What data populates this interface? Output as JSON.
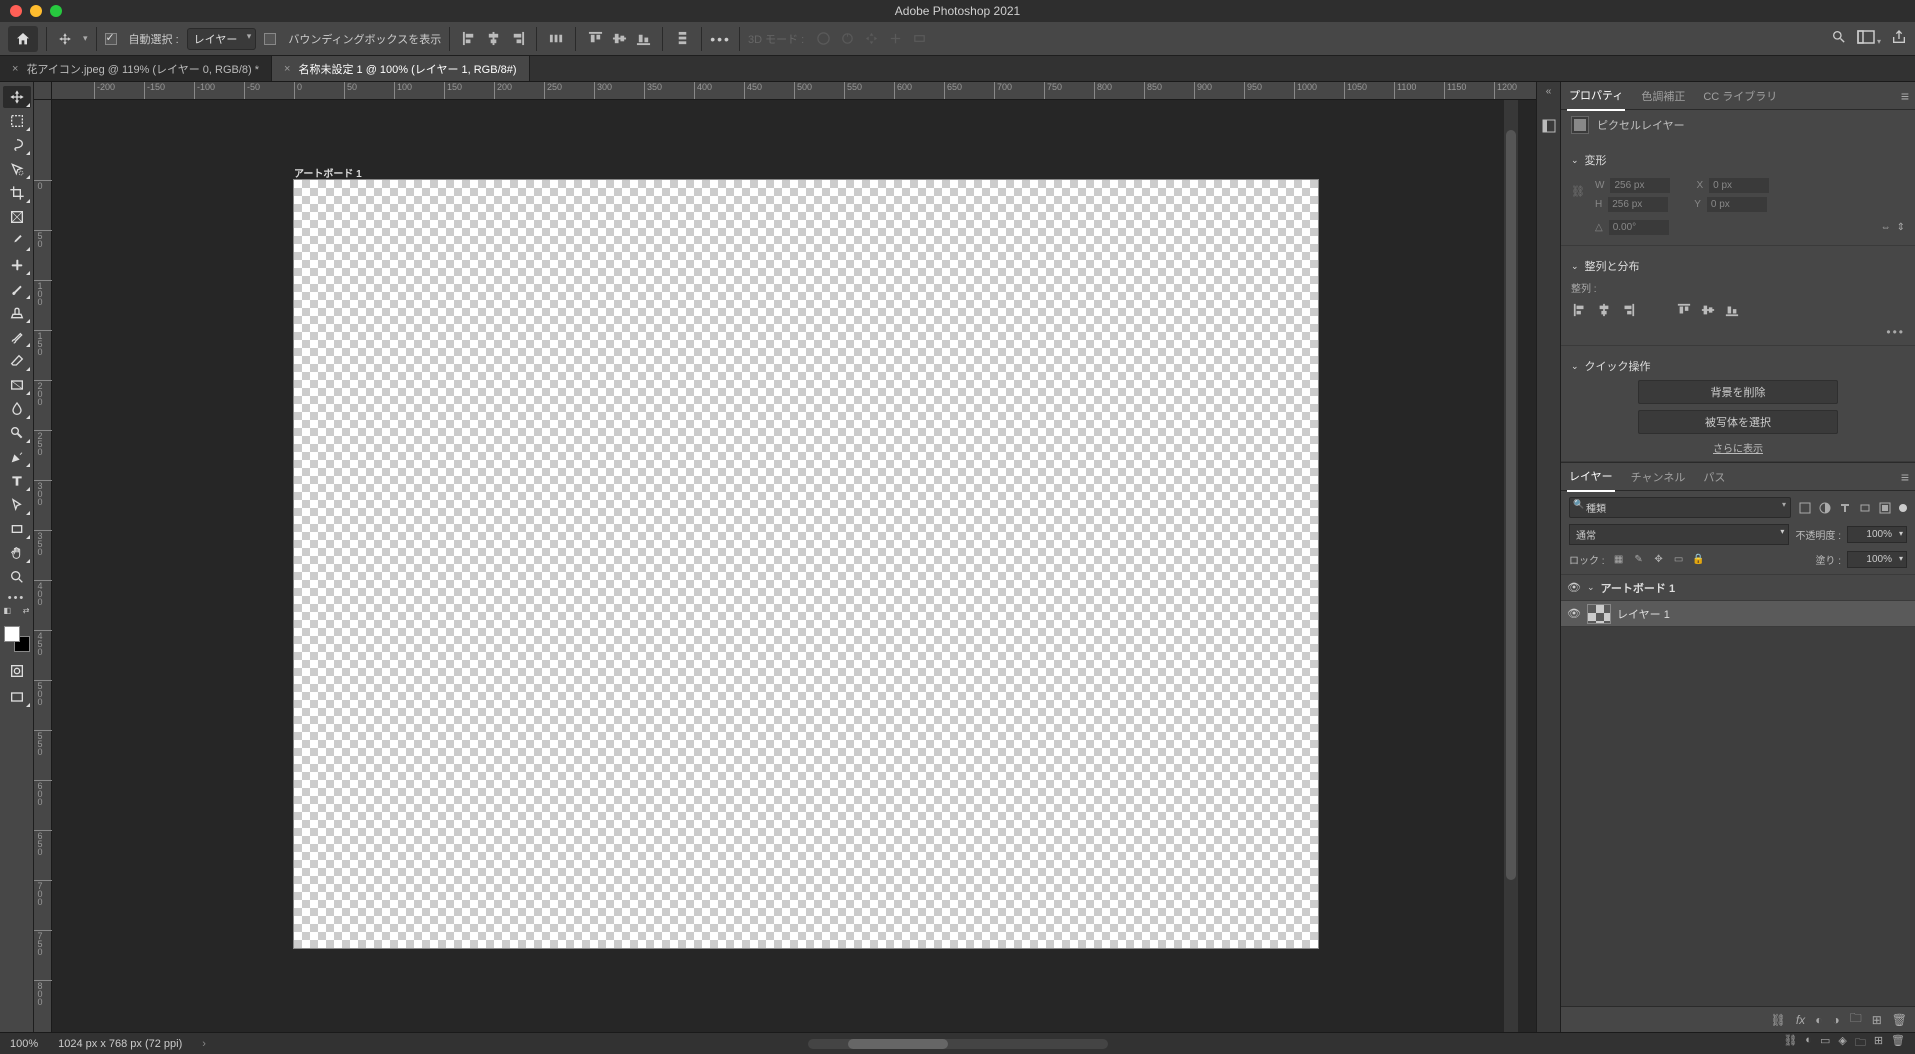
{
  "app": {
    "title": "Adobe Photoshop 2021"
  },
  "options": {
    "auto_select_label": "自動選択 :",
    "layer_dropdown": "レイヤー",
    "bounding_box_label": "バウンディングボックスを表示",
    "threeDMode": "3D モード :"
  },
  "tabs": [
    {
      "label": "花アイコン.jpeg @ 119% (レイヤー 0, RGB/8) *",
      "active": false
    },
    {
      "label": "名称未設定 1 @ 100% (レイヤー 1, RGB/8#)",
      "active": true
    }
  ],
  "ruler_h": [
    "-200",
    "-150",
    "-100",
    "-50",
    "0",
    "50",
    "100",
    "150",
    "200",
    "250",
    "300",
    "350",
    "400",
    "450",
    "500",
    "550",
    "600",
    "650",
    "700",
    "750",
    "800",
    "850",
    "900",
    "950",
    "1000",
    "1050",
    "1100",
    "1150",
    "1200"
  ],
  "ruler_v": [
    "0",
    "50",
    "100",
    "150",
    "200",
    "250",
    "300",
    "350",
    "400",
    "450",
    "500",
    "550",
    "600",
    "650",
    "700",
    "750",
    "800"
  ],
  "artboard": {
    "label": "アートボード 1"
  },
  "panels": {
    "properties_tabs": [
      "プロパティ",
      "色調補正",
      "CC ライブラリ"
    ],
    "pixel_layer_label": "ピクセルレイヤー",
    "transform_label": "変形",
    "w_label": "W",
    "w_value": "256 px",
    "h_label": "H",
    "h_value": "256 px",
    "x_label": "X",
    "x_value": "0 px",
    "y_label": "Y",
    "y_value": "0 px",
    "angle_value": "0.00°",
    "align_label": "整列と分布",
    "align_sub": "整列 :",
    "quick_actions_label": "クイック操作",
    "qa_buttons": [
      "背景を削除",
      "被写体を選択"
    ],
    "more_label": "さらに表示"
  },
  "layers": {
    "tabs": [
      "レイヤー",
      "チャンネル",
      "パス"
    ],
    "search_placeholder": "種類",
    "blend_mode": "通常",
    "opacity_label": "不透明度 :",
    "opacity_value": "100%",
    "lock_label": "ロック :",
    "fill_label": "塗り :",
    "fill_value": "100%",
    "items": [
      {
        "type": "artboard",
        "name": "アートボード 1",
        "selected": false
      },
      {
        "type": "layer",
        "name": "レイヤー 1",
        "selected": true
      }
    ]
  },
  "status": {
    "zoom": "100%",
    "doc_info": "1024 px x 768 px (72 ppi)"
  }
}
